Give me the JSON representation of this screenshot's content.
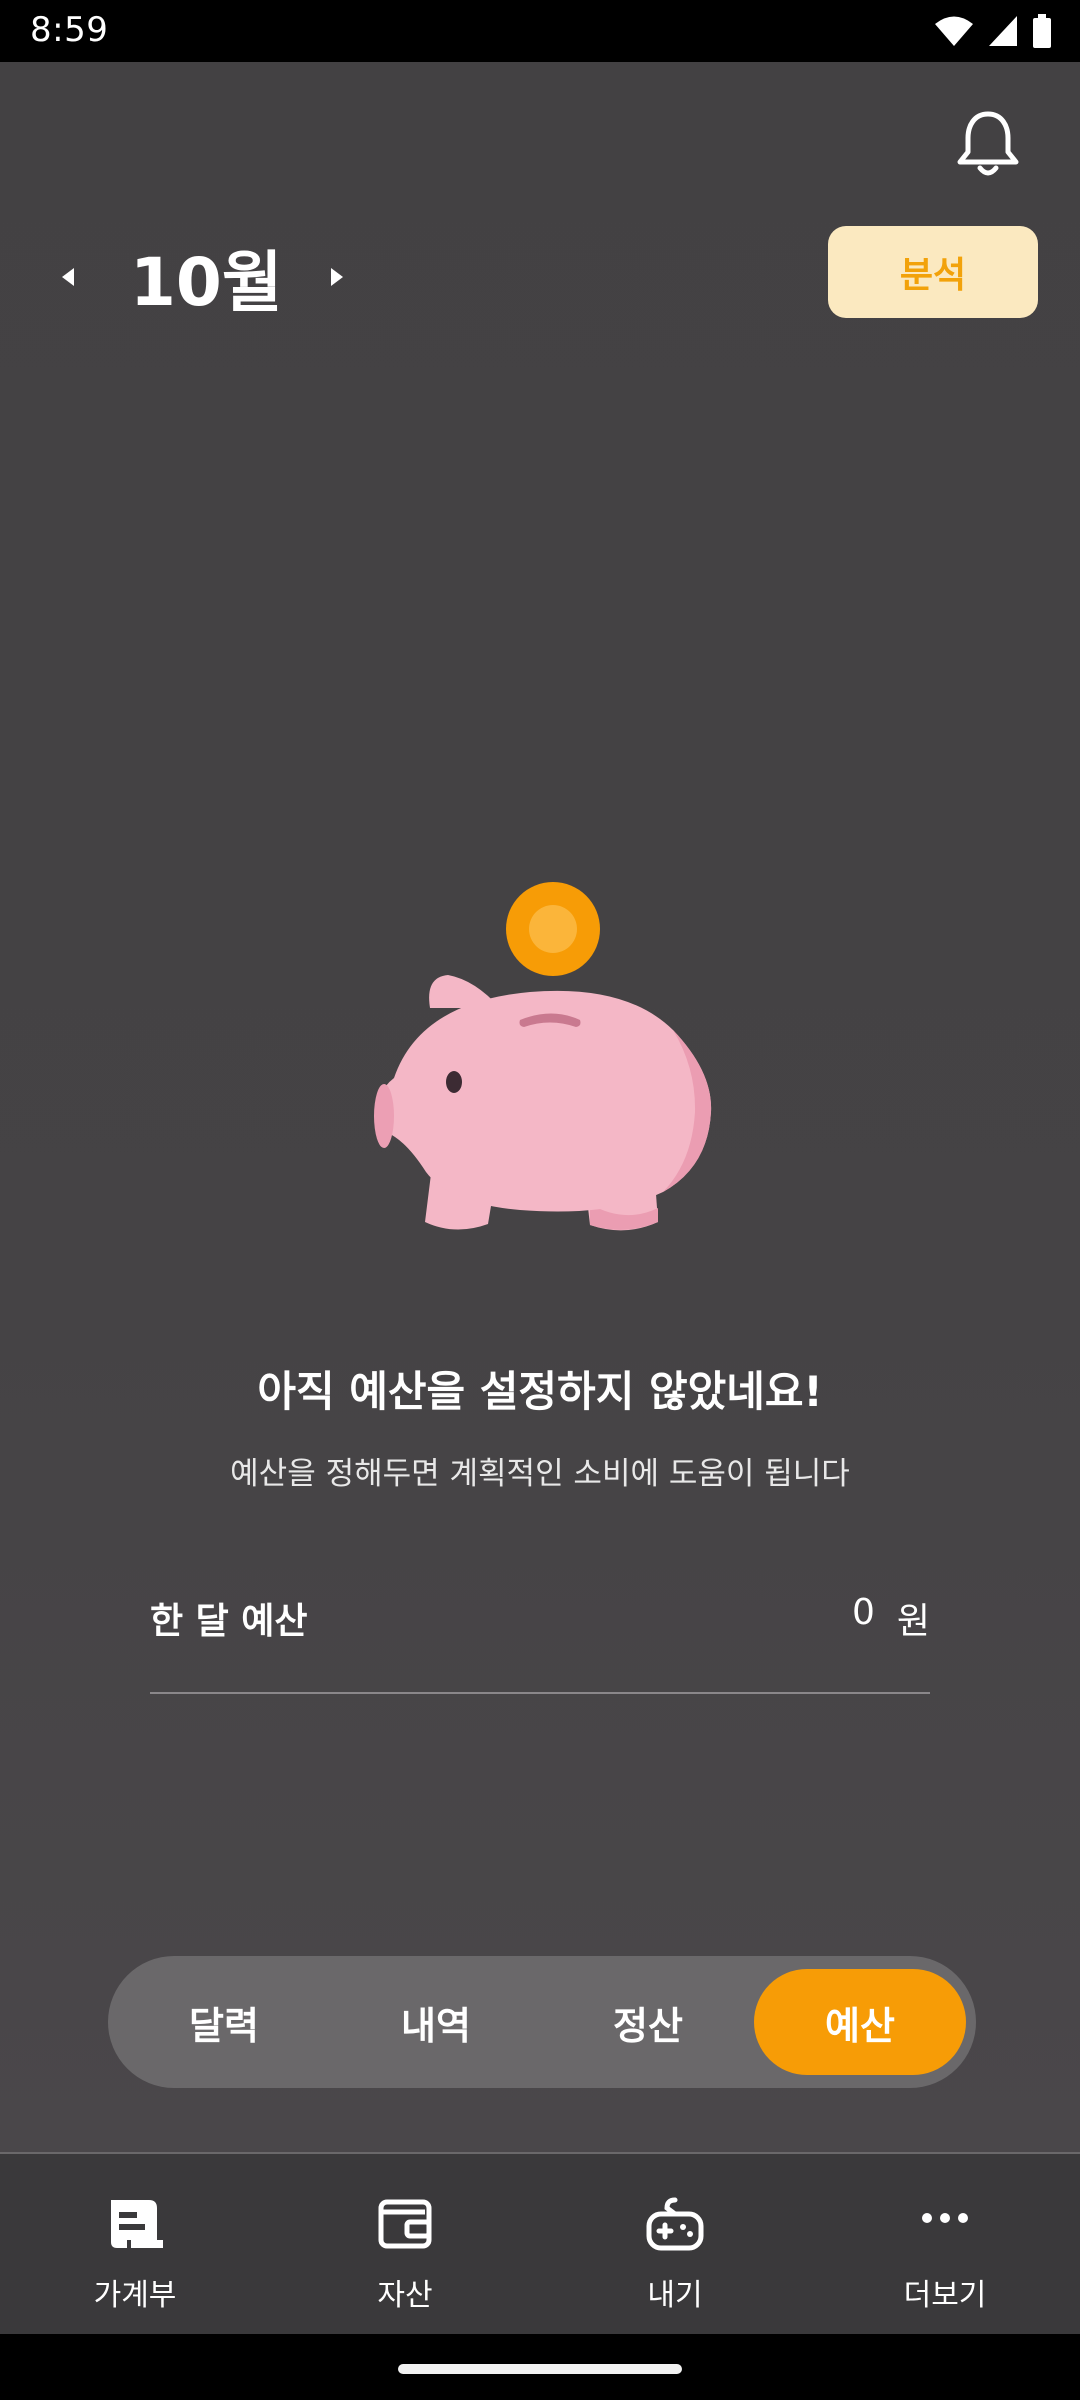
{
  "status": {
    "time": "8:59"
  },
  "header": {
    "month": "10월",
    "analysis_label": "분석"
  },
  "empty_state": {
    "title": "아직 예산을 설정하지 않았네요!",
    "subtitle": "예산을 정해두면 계획적인 소비에 도움이 됩니다"
  },
  "budget": {
    "label": "한 달 예산",
    "amount": "0",
    "unit": "원"
  },
  "segments": [
    {
      "label": "달력",
      "active": false
    },
    {
      "label": "내역",
      "active": false
    },
    {
      "label": "정산",
      "active": false
    },
    {
      "label": "예산",
      "active": true
    }
  ],
  "tabs": [
    {
      "label": "가계부",
      "icon": "ledger-icon"
    },
    {
      "label": "자산",
      "icon": "wallet-icon"
    },
    {
      "label": "내기",
      "icon": "gamepad-icon"
    },
    {
      "label": "더보기",
      "icon": "more-icon"
    }
  ],
  "colors": {
    "accent": "#f79c06",
    "analysis_bg": "#fbe9c0",
    "background": "#444244",
    "piggy": "#f4b7c6"
  }
}
